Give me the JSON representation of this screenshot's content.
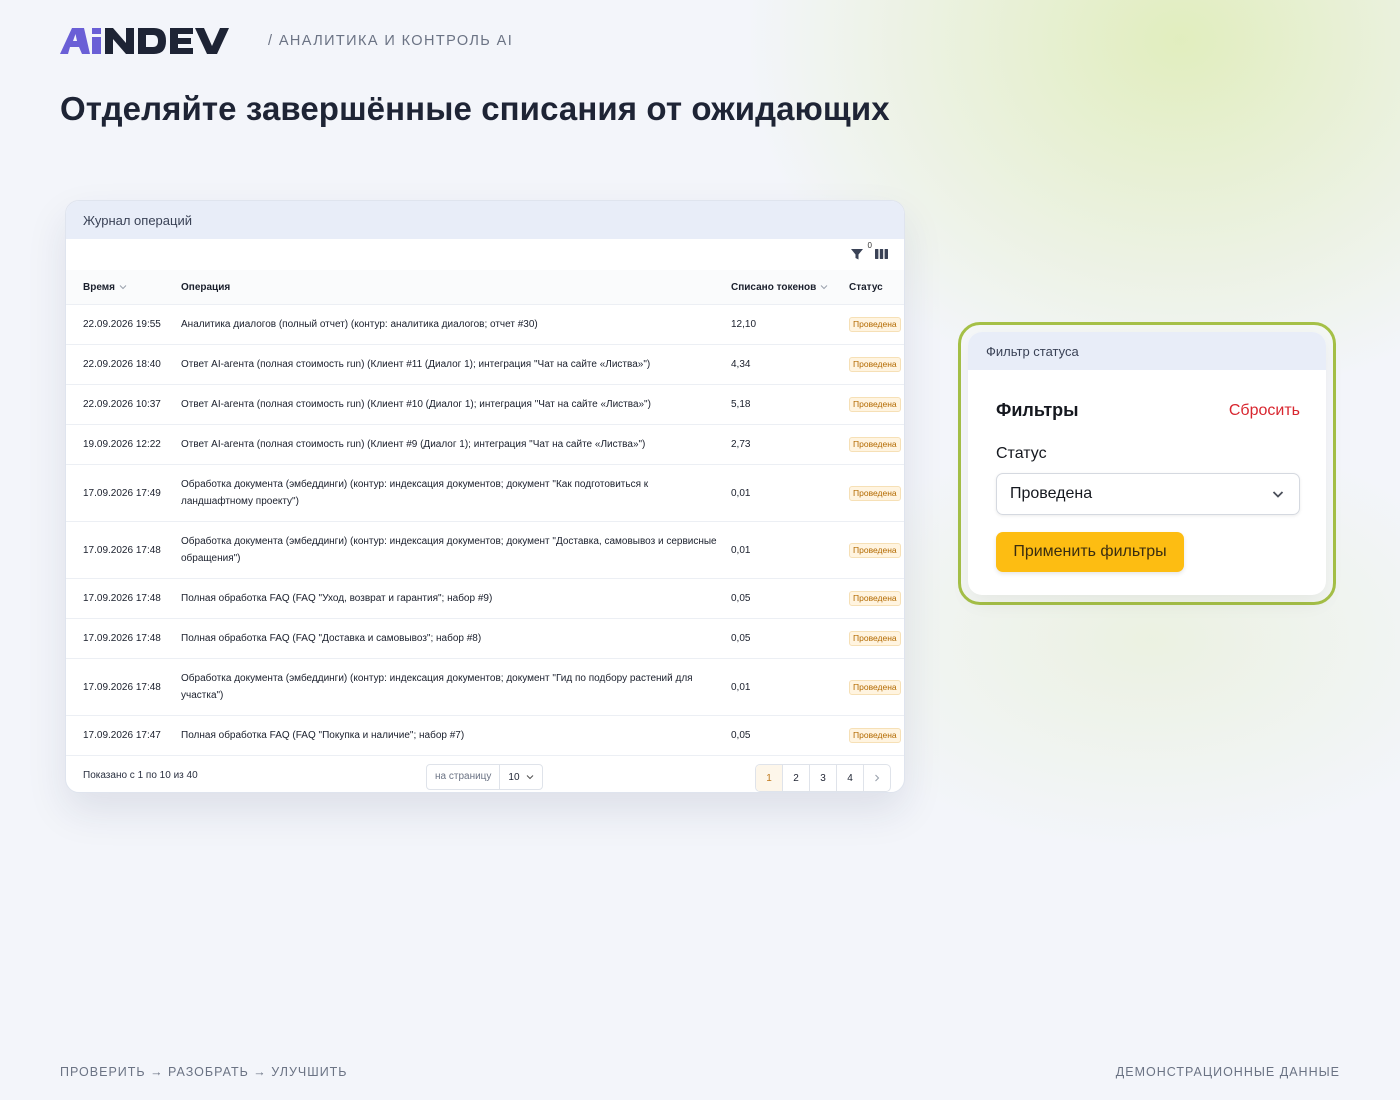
{
  "brand": {
    "logo_text": "AiNDEV",
    "accent": "#6a5fd6",
    "dark": "#1e2435"
  },
  "tagline": "/ АНАЛИТИКА И КОНТРОЛЬ AI",
  "headline": "Отделяйте завершённые списания от ожидающих",
  "journal": {
    "title": "Журнал операций",
    "filter_count": "0",
    "columns": {
      "time": "Время",
      "operation": "Операция",
      "tokens": "Списано токенов",
      "status": "Статус"
    },
    "rows": [
      {
        "time": "22.09.2026 19:55",
        "operation": "Аналитика диалогов (полный отчет) (контур: аналитика диалогов; отчет #30)",
        "tokens": "12,10",
        "status": "Проведена",
        "tall": false
      },
      {
        "time": "22.09.2026 18:40",
        "operation": "Ответ AI-агента (полная стоимость run) (Клиент #11 (Диалог 1); интеграция \"Чат на сайте «Листва»\")",
        "tokens": "4,34",
        "status": "Проведена",
        "tall": false
      },
      {
        "time": "22.09.2026 10:37",
        "operation": "Ответ AI-агента (полная стоимость run) (Клиент #10 (Диалог 1); интеграция \"Чат на сайте «Листва»\")",
        "tokens": "5,18",
        "status": "Проведена",
        "tall": false
      },
      {
        "time": "19.09.2026 12:22",
        "operation": "Ответ AI-агента (полная стоимость run) (Клиент #9 (Диалог 1); интеграция \"Чат на сайте «Листва»\")",
        "tokens": "2,73",
        "status": "Проведена",
        "tall": false
      },
      {
        "time": "17.09.2026 17:49",
        "operation": "Обработка документа (эмбеддинги) (контур: индексация документов; документ \"Как подготовиться к ландшафтному проекту\")",
        "tokens": "0,01",
        "status": "Проведена",
        "tall": true
      },
      {
        "time": "17.09.2026 17:48",
        "operation": "Обработка документа (эмбеддинги) (контур: индексация документов; документ \"Доставка, самовывоз и сервисные обращения\")",
        "tokens": "0,01",
        "status": "Проведена",
        "tall": true
      },
      {
        "time": "17.09.2026 17:48",
        "operation": "Полная обработка FAQ (FAQ \"Уход, возврат и гарантия\"; набор #9)",
        "tokens": "0,05",
        "status": "Проведена",
        "tall": false
      },
      {
        "time": "17.09.2026 17:48",
        "operation": "Полная обработка FAQ (FAQ \"Доставка и самовывоз\"; набор #8)",
        "tokens": "0,05",
        "status": "Проведена",
        "tall": false
      },
      {
        "time": "17.09.2026 17:48",
        "operation": "Обработка документа (эмбеддинги) (контур: индексация документов; документ \"Гид по подбору растений для участка\")",
        "tokens": "0,01",
        "status": "Проведена",
        "tall": true
      },
      {
        "time": "17.09.2026 17:47",
        "operation": "Полная обработка FAQ (FAQ \"Покупка и наличие\"; набор #7)",
        "tokens": "0,05",
        "status": "Проведена",
        "tall": false
      }
    ],
    "pagination": {
      "shown": "Показано с 1 по 10 из 40",
      "per_page_label": "на страницу",
      "per_page_value": "10",
      "pages": [
        "1",
        "2",
        "3",
        "4"
      ],
      "active_page": "1"
    }
  },
  "filter_panel": {
    "title": "Фильтр статуса",
    "heading": "Фильтры",
    "reset_label": "Сбросить",
    "status_label": "Статус",
    "status_value": "Проведена",
    "apply_label": "Применить фильтры",
    "highlight_color": "#a5c047",
    "apply_color": "#fdbd12",
    "reset_color": "#d8262f"
  },
  "footer": {
    "left": "ПРОВЕРИТЬ → РАЗОБРАТЬ → УЛУЧШИТЬ",
    "right": "ДЕМОНСТРАЦИОННЫЕ ДАННЫЕ"
  }
}
